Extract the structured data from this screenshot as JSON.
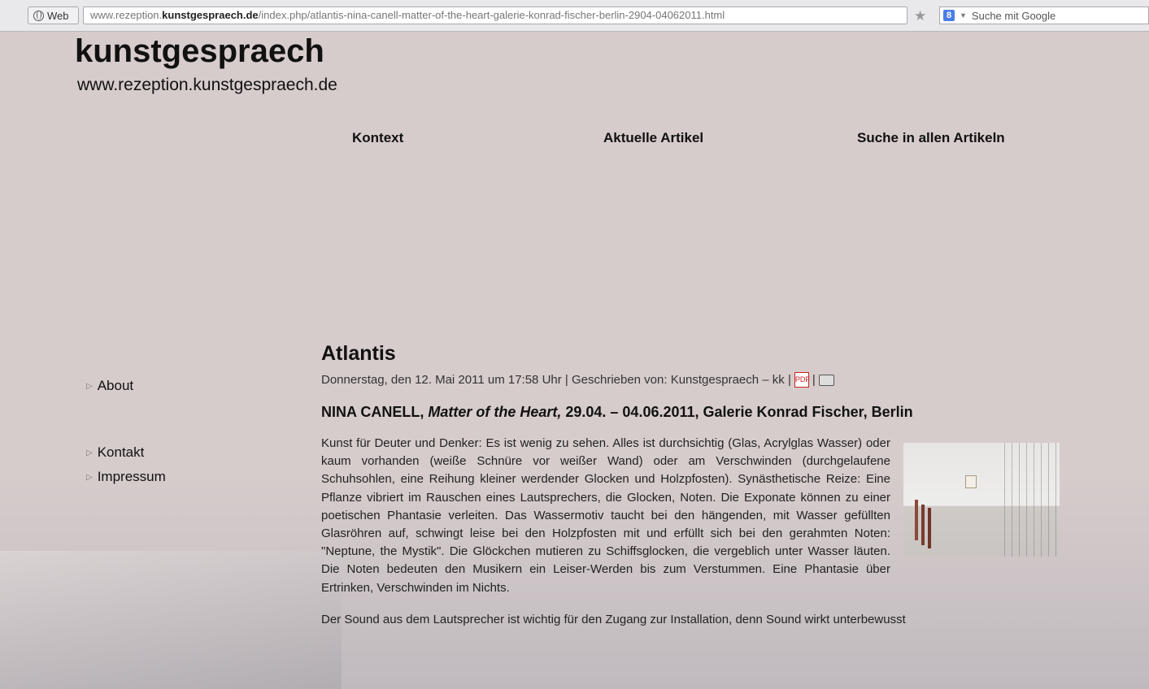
{
  "browser": {
    "site_button_label": "Web",
    "url_host_prefix": "www.rezeption.",
    "url_host_bold": "kunstgespraech.de",
    "url_path": "/index.php/atlantis-nina-canell-matter-of-the-heart-galerie-konrad-fischer-berlin-2904-04062011.html",
    "search_placeholder": "Suche mit Google",
    "search_engine_icon": "google-icon"
  },
  "site": {
    "title": "kunstgespraech",
    "url": "www.rezeption.kunstgespraech.de"
  },
  "nav": {
    "items": [
      {
        "label": "Kontext"
      },
      {
        "label": "Aktuelle Artikel"
      },
      {
        "label": "Suche in allen Artikeln"
      }
    ]
  },
  "sidebar": {
    "items": [
      {
        "label": "About"
      },
      {
        "label": "Kontakt"
      },
      {
        "label": "Impressum"
      }
    ]
  },
  "article": {
    "title": "Atlantis",
    "meta": "Donnerstag, den 12. Mai 2011 um 17:58 Uhr | Geschrieben von: Kunstgespraech – kk |",
    "meta_sep": "|",
    "subhead_a": "NINA CANELL, ",
    "subhead_b": "Matter of the Heart,",
    "subhead_c": " 29.04. – 04.06.2011, Galerie Konrad Fischer, Berlin",
    "paragraph1": "Kunst für Deuter und Denker: Es ist wenig zu sehen. Alles ist durchsichtig (Glas, Acrylglas Wasser) oder kaum vorhanden (weiße Schnüre vor weißer Wand) oder am Verschwinden (durchgelaufene Schuhsohlen, eine Reihung kleiner werdender Glocken und Holzpfosten). Synästhetische Reize: Eine Pflanze vibriert im Rauschen eines Lautsprechers, die Glocken, Noten. Die Exponate können zu einer poetischen Phantasie verleiten. Das Wassermotiv taucht bei den hängenden, mit Wasser gefüllten Glasröhren auf, schwingt leise bei den Holzpfosten mit und erfüllt sich bei den gerahmten Noten: \"Neptune, the Mystik\". Die Glöckchen mutieren zu Schiffsglocken, die vergeblich unter Wasser läuten. Die Noten bedeuten den Musikern ein Leiser-Werden bis zum Verstummen. Eine Phantasie über Ertrinken, Verschwinden im Nichts.",
    "paragraph2": "Der Sound aus dem Lautsprecher ist wichtig für den Zugang zur Installation, denn Sound wirkt unterbewusst"
  }
}
